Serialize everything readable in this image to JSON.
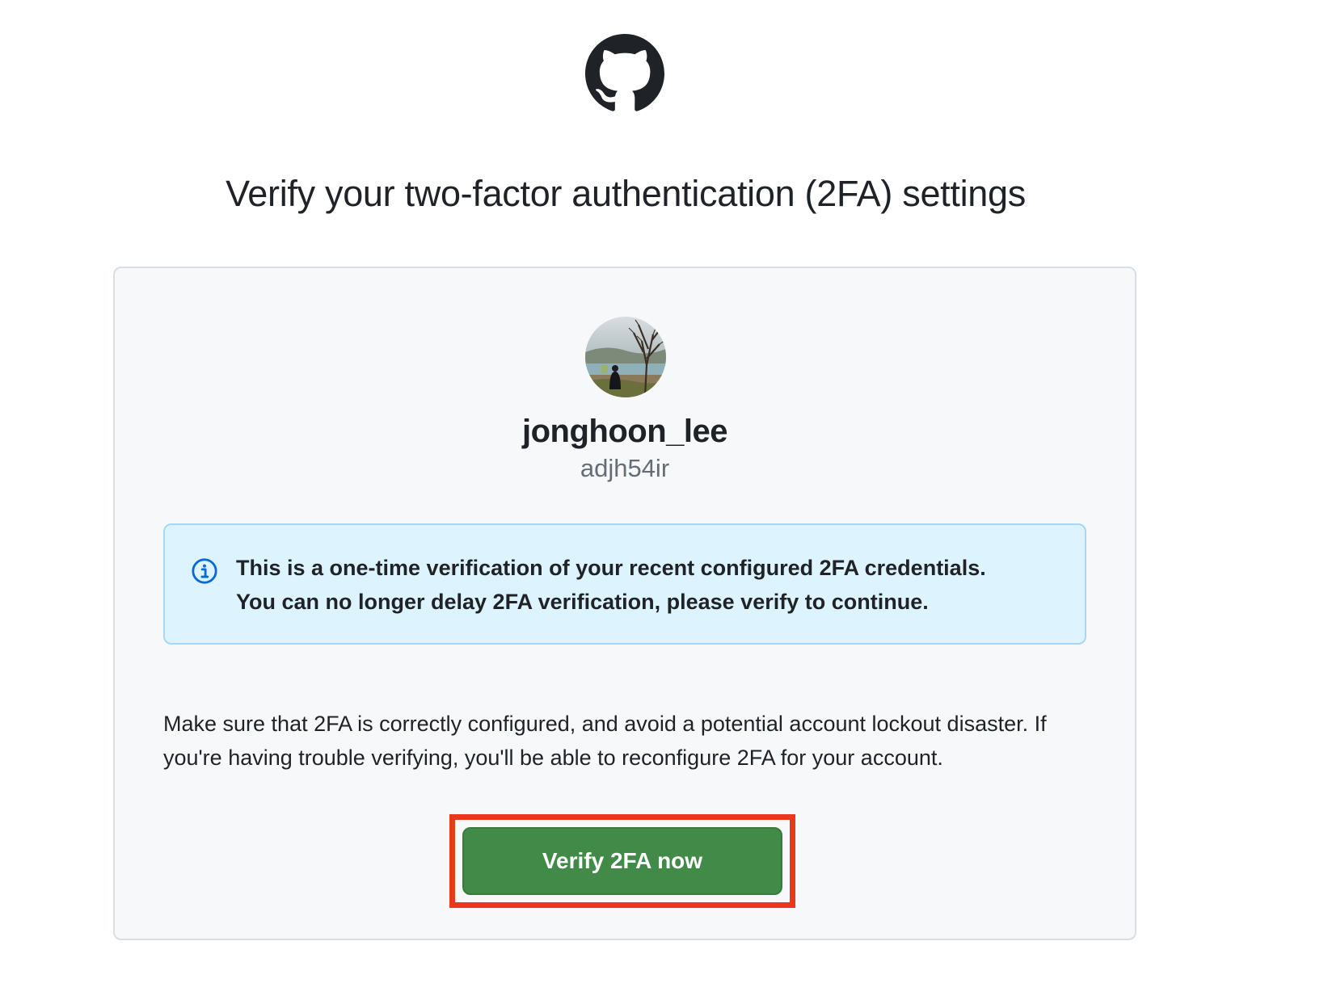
{
  "header": {
    "logo_icon": "github-mark-icon",
    "title": "Verify your two-factor authentication (2FA) settings"
  },
  "profile": {
    "avatar_icon": "user-avatar",
    "display_name": "jonghoon_lee",
    "login": "adjh54ir"
  },
  "notice": {
    "icon": "info-icon",
    "line1": "This is a one-time verification of your recent configured 2FA credentials.",
    "line2": "You can no longer delay 2FA verification, please verify to continue."
  },
  "body": {
    "text": "Make sure that 2FA is correctly configured, and avoid a potential account lockout disaster. If you're having trouble verifying, you'll be able to reconfigure 2FA for your account."
  },
  "actions": {
    "verify_label": "Verify 2FA now"
  },
  "colors": {
    "primary_button": "#428a47",
    "notice_background": "#ddf4ff",
    "notice_border": "#a8d6f5",
    "highlight": "#e8391d",
    "card_background": "#f6f8fa"
  }
}
